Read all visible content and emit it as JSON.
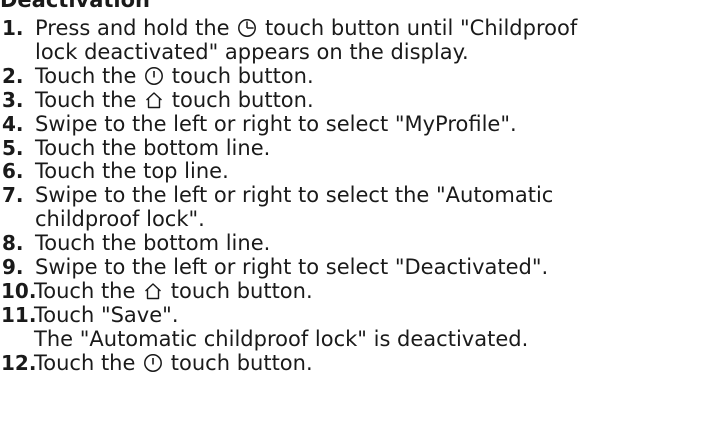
{
  "heading": "Deactivation",
  "steps": [
    {
      "number": "1.",
      "line1_pre": "Press and hold the ",
      "line1_post": " touch button until \"Childproof",
      "line2": "lock deactivated\" appears on the display."
    },
    {
      "number": "2.",
      "pre": "Touch the ",
      "post": " touch button."
    },
    {
      "number": "3.",
      "pre": "Touch the ",
      "post": " touch button."
    },
    {
      "number": "4.",
      "text": "Swipe to the left or right to select \"MyProfile\"."
    },
    {
      "number": "5.",
      "text": "Touch the bottom line."
    },
    {
      "number": "6.",
      "text": "Touch the top line."
    },
    {
      "number": "7.",
      "line1": "Swipe to the left or right to select the \"Automatic",
      "line2": "childproof lock\"."
    },
    {
      "number": "8.",
      "text": "Touch the bottom line."
    },
    {
      "number": "9.",
      "text": "Swipe to the left or right to select \"Deactivated\"."
    },
    {
      "number": "10.",
      "pre": "Touch the ",
      "post": " touch button."
    },
    {
      "number": "11.",
      "line1": "Touch \"Save\".",
      "line2": "The \"Automatic childproof lock\" is deactivated."
    },
    {
      "number": "12.",
      "pre": "Touch the ",
      "post": " touch button."
    }
  ],
  "icons": {
    "timer": "timer-icon",
    "power": "power-icon",
    "home": "home-icon"
  },
  "colors": {
    "text": "#1a1a1a",
    "background": "#ffffff"
  }
}
